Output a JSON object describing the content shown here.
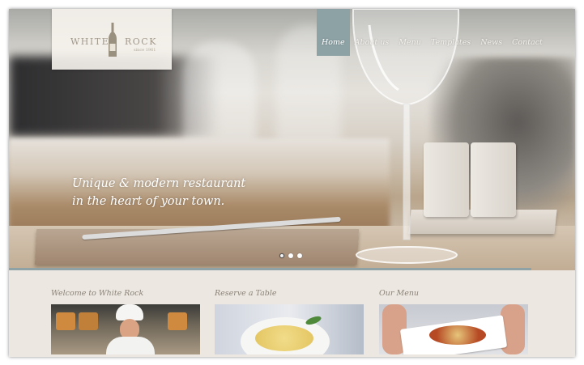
{
  "brand": {
    "name_left": "WHITE",
    "name_right": "ROCK",
    "since": "since 1961"
  },
  "nav": {
    "items": [
      {
        "label": "Home",
        "active": true
      },
      {
        "label": "About us",
        "active": false
      },
      {
        "label": "Menu",
        "active": false
      },
      {
        "label": "Templates",
        "active": false
      },
      {
        "label": "News",
        "active": false
      },
      {
        "label": "Contact",
        "active": false
      }
    ]
  },
  "hero": {
    "tagline_line1": "Unique & modern restaurant",
    "tagline_line2": "in the heart of your town.",
    "slides": {
      "count": 3,
      "active_index": 0
    }
  },
  "sections": {
    "welcome": {
      "title": "Welcome to White Rock",
      "image_icon": "chef-photo"
    },
    "reserve": {
      "title": "Reserve a Table",
      "image_icon": "pasta-photo"
    },
    "menu": {
      "title": "Our Menu",
      "image_icon": "dish-photo"
    }
  },
  "colors": {
    "accent": "#8da2a5",
    "background": "#ece7e1",
    "heading_text": "#8a8277",
    "logo_text": "#a3998c"
  }
}
